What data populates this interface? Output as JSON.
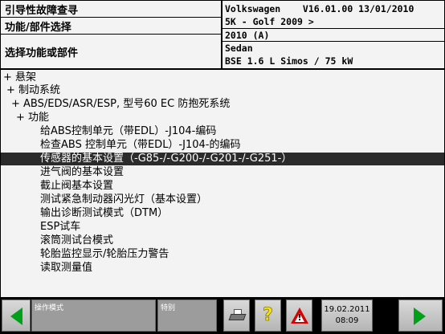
{
  "header": {
    "left": {
      "title": "引导性故障查寻",
      "subtitle": "功能/部件选择",
      "instruction": "选择功能或部件"
    },
    "right": {
      "line1": "Volkswagen    V16.01.00 13/01/2010",
      "line2": "5K - Golf 2009 >",
      "line3": "2010 (A)",
      "line4": "Sedan",
      "line5": "BSE 1.6 L Simos / 75 kW"
    }
  },
  "tree": {
    "items": [
      "+ 悬架",
      "+ 制动系统",
      "+ ABS/EDS/ASR/ESP, 型号60 EC 防抱死系统",
      "+ 功能",
      "给ABS控制单元（带EDL）-J104-编码",
      "检查ABS 控制单元（带EDL）-J104-的编码",
      "传感器的基本设置（-G85-/-G200-/-G201-/-G251-）",
      "进气阀的基本设置",
      "截止阀基本设置",
      "测试紧急制动器闪光灯（基本设置）",
      "输出诊断测试模式（DTM）",
      "ESP试车",
      "滚筒测试台模式",
      "轮胎监控显示/轮胎压力警告",
      "读取测量值"
    ],
    "selected_index": 6
  },
  "bottom_bar": {
    "mode_label": "操作模式",
    "special_label": "特别",
    "help_symbol": "?",
    "warning_symbol": "!",
    "date": "19.02.2011",
    "time": "08:09"
  },
  "icons": {
    "back": "left-arrow-icon",
    "forward": "right-arrow-icon",
    "print": "printer-icon",
    "help": "question-mark-icon",
    "warning": "warning-triangle-icon"
  },
  "colors": {
    "nav_arrow": "#00a01a",
    "selection_bg": "#2b2b2b",
    "warning": "#d80000",
    "help": "#f6e400"
  }
}
